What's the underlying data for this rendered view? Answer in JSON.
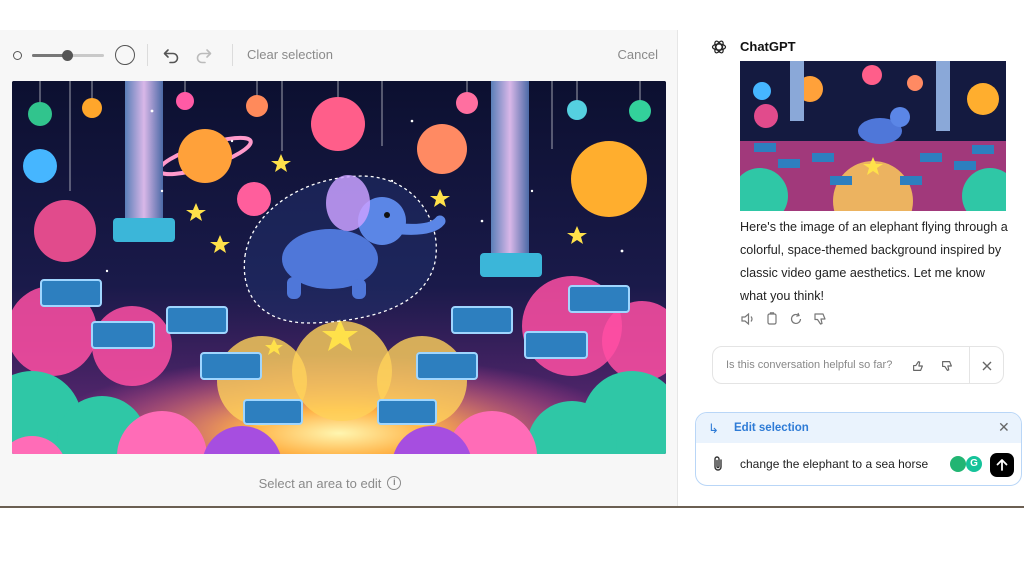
{
  "editor": {
    "toolbar": {
      "brush_size_percent": 48,
      "clear_selection_label": "Clear selection",
      "cancel_label": "Cancel",
      "icons": [
        "brush-small-icon",
        "brush-large-icon",
        "undo-icon",
        "redo-icon"
      ]
    },
    "hint_text": "Select an area to edit",
    "hint_icon": "info-icon"
  },
  "chat": {
    "sender": "ChatGPT",
    "sender_icon": "chatgpt-logo-icon",
    "message": "Here's the image of an elephant flying through a colorful, space-themed background inspired by classic video game aesthetics. Let me know what you think!",
    "action_icons": [
      "read-aloud-icon",
      "copy-icon",
      "regenerate-icon",
      "thumbs-down-icon"
    ],
    "feedback": {
      "question": "Is this conversation helpful so far?",
      "icons": [
        "thumbs-up-icon",
        "thumbs-down-icon",
        "close-icon"
      ]
    },
    "edit_selection": {
      "title": "Edit selection",
      "prompt_value": "change the elephant to a sea horse",
      "icons": [
        "reply-arrow-icon",
        "close-icon",
        "attach-icon",
        "send-icon"
      ]
    }
  },
  "colors": {
    "accent_blue": "#2e7bd6",
    "edit_header_bg": "#eaf3fd",
    "editor_bg": "#f7f7f7",
    "send_button": "#000000"
  }
}
